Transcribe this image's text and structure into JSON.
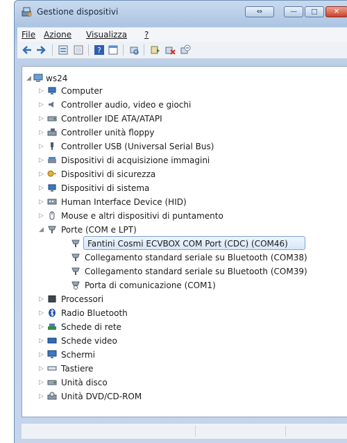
{
  "window": {
    "title": "Gestione dispositivi"
  },
  "menu": {
    "items": [
      "File",
      "Azione",
      "Visualizza",
      "?"
    ]
  },
  "toolbar": {
    "buttons": [
      "back-icon",
      "forward-icon",
      "properties-icon",
      "view-icon",
      "help-icon",
      "panel-icon",
      "scan-icon",
      "update-driver-icon",
      "uninstall-icon",
      "disable-icon"
    ]
  },
  "tree": {
    "root": "ws24",
    "items": [
      "Computer",
      "Controller audio, video e giochi",
      "Controller IDE ATA/ATAPI",
      "Controller unità floppy",
      "Controller USB (Universal Serial Bus)",
      "Dispositivi di acquisizione immagini",
      "Dispositivi di sicurezza",
      "Dispositivi di sistema",
      "Human Interface Device (HID)",
      "Mouse e altri dispositivi di puntamento",
      "Porte (COM e LPT)",
      "Processori",
      "Radio Bluetooth",
      "Schede di rete",
      "Schede video",
      "Schermi",
      "Tastiere",
      "Unità disco",
      "Unità DVD/CD-ROM"
    ],
    "ports_children": [
      "Fantini Cosmi ECVBOX COM Port (CDC) (COM46)",
      "Collegamento standard seriale su Bluetooth (COM38)",
      "Collegamento standard seriale su Bluetooth (COM39)",
      "Porta di comunicazione (COM1)"
    ],
    "selected": "Fantini Cosmi ECVBOX COM Port (CDC) (COM46)"
  }
}
